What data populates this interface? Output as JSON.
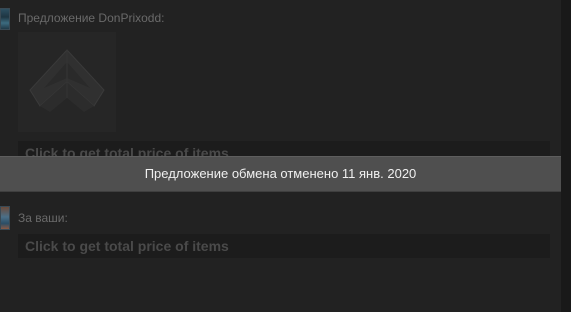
{
  "offer": {
    "their_label": "Предложение DonPrixodd:",
    "their_price_link": "Click to get total price of items",
    "your_label": "За ваши:",
    "your_price_link": "Click to get total price of items"
  },
  "status": {
    "text": "Предложение обмена отменено 11 янв. 2020"
  },
  "items": [
    {
      "icon": "item-emblem-icon"
    }
  ],
  "colors": {
    "background": "#222222",
    "notice_banner": "#4f4f4f",
    "notice_text": "#f0f0f0",
    "muted_text": "#6a6a6a",
    "link_text": "#4a4a4a"
  }
}
